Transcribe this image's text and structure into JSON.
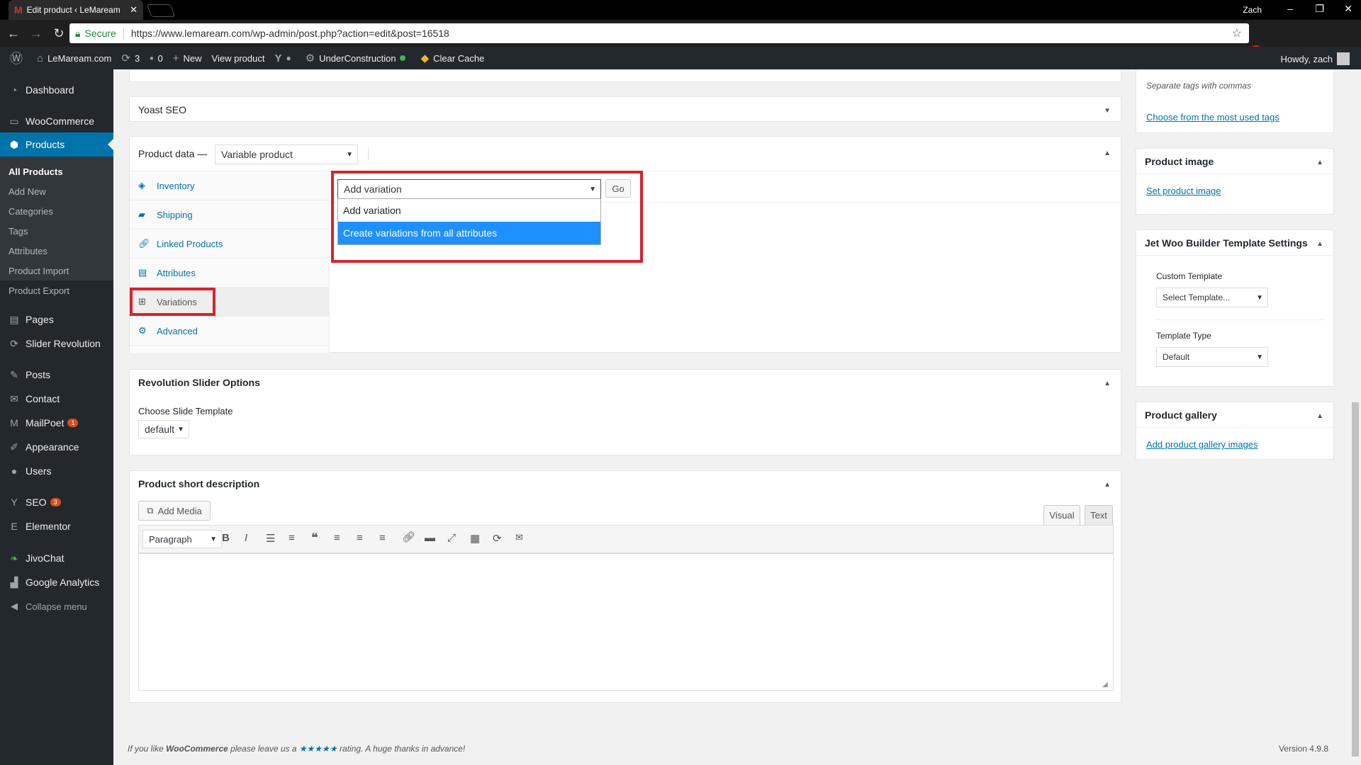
{
  "browser": {
    "tab_title": "Edit product ‹ LeMaream",
    "tab_close": "✕",
    "user": "Zach",
    "secure_label": "Secure",
    "url": "https://www.lemaream.com/wp-admin/post.php?action=edit&post=16518",
    "win_min": "–",
    "win_max": "❐",
    "win_close": "✕"
  },
  "adminbar": {
    "site": "LeMaream.com",
    "updates": "3",
    "comments": "0",
    "new": "New",
    "view_product": "View product",
    "underconstruction": "UnderConstruction",
    "clear_cache": "Clear Cache",
    "howdy": "Howdy, zach"
  },
  "sidebar": {
    "items": [
      {
        "label": "Dashboard",
        "icon": "dashboard-icon"
      },
      {
        "label": "WooCommerce",
        "icon": "woocommerce-icon"
      },
      {
        "label": "Products",
        "icon": "products-icon"
      },
      {
        "label": "Pages",
        "icon": "pages-icon"
      },
      {
        "label": "Slider Revolution",
        "icon": "slider-icon"
      },
      {
        "label": "Posts",
        "icon": "posts-icon"
      },
      {
        "label": "Contact",
        "icon": "contact-icon"
      },
      {
        "label": "MailPoet",
        "icon": "mailpoet-icon",
        "badge": "1"
      },
      {
        "label": "Appearance",
        "icon": "appearance-icon"
      },
      {
        "label": "Users",
        "icon": "users-icon"
      },
      {
        "label": "SEO",
        "icon": "seo-icon",
        "badge": "3"
      },
      {
        "label": "Elementor",
        "icon": "elementor-icon"
      },
      {
        "label": "JivoChat",
        "icon": "jivochat-icon"
      },
      {
        "label": "Google Analytics",
        "icon": "analytics-icon"
      },
      {
        "label": "Collapse menu",
        "icon": "collapse-icon"
      }
    ],
    "submenu": [
      "All Products",
      "Add New",
      "Categories",
      "Tags",
      "Attributes",
      "Product Import",
      "Product Export"
    ]
  },
  "yoast": {
    "title": "Yoast SEO"
  },
  "product_data": {
    "title": "Product data —",
    "type_selected": "Variable product",
    "tabs": [
      "Inventory",
      "Shipping",
      "Linked Products",
      "Attributes",
      "Variations",
      "Advanced"
    ],
    "variation_select": "Add variation",
    "go": "Go",
    "dropdown_options": [
      "Add variation",
      "Create variations from all attributes"
    ]
  },
  "revslider": {
    "title": "Revolution Slider Options",
    "choose_label": "Choose Slide Template",
    "selected": "default"
  },
  "short_desc": {
    "title": "Product short description",
    "add_media": "Add Media",
    "visual": "Visual",
    "text": "Text",
    "format": "Paragraph"
  },
  "right": {
    "tags_hint": "Separate tags with commas",
    "tags_link": "Choose from the most used tags",
    "product_image_title": "Product image",
    "set_image": "Set product image",
    "jet_title": "Jet Woo Builder Template Settings",
    "custom_template_label": "Custom Template",
    "custom_template_value": "Select Template...",
    "template_type_label": "Template Type",
    "template_type_value": "Default",
    "gallery_title": "Product gallery",
    "gallery_link": "Add product gallery images"
  },
  "footer": {
    "thanks_pre": "If you like ",
    "brand": "WooCommerce",
    "thanks_mid": " please leave us a ",
    "stars": "★★★★★",
    "thanks_post": " rating. A huge thanks in advance!",
    "version": "Version 4.9.8"
  },
  "colors": {
    "accent": "#0073aa",
    "highlight": "#d6232f"
  }
}
